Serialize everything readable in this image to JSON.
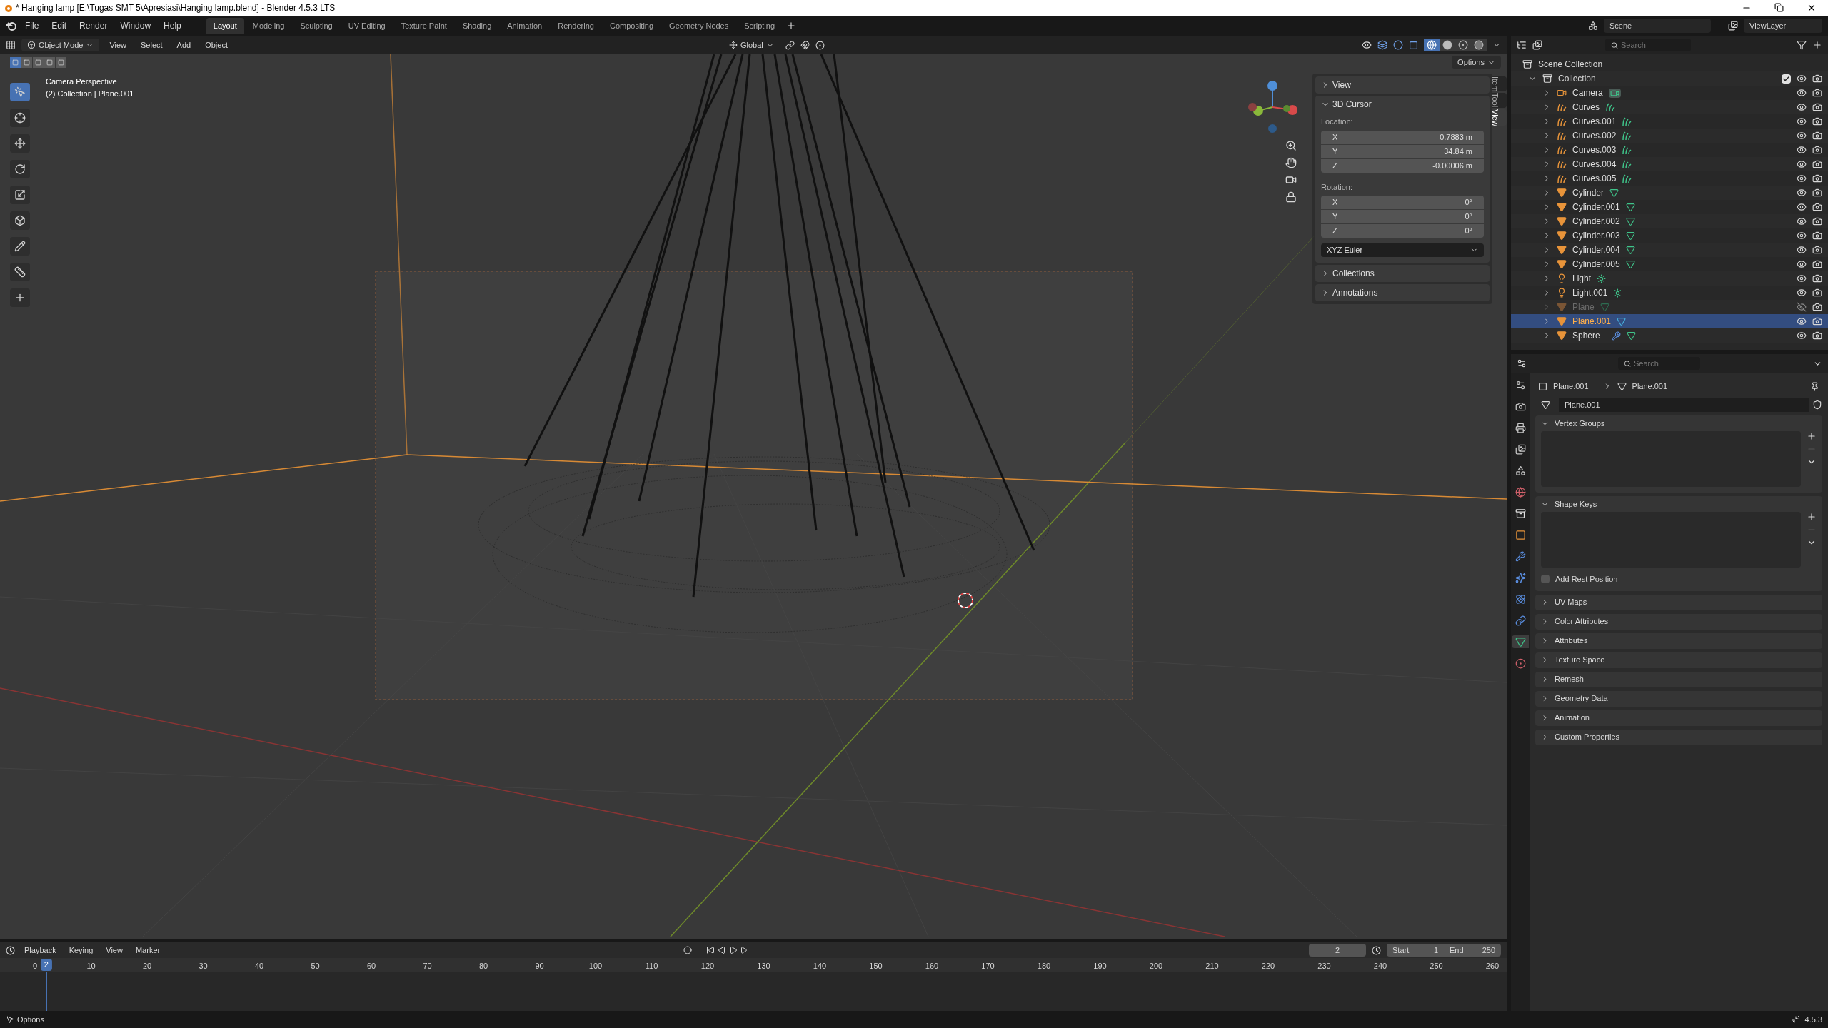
{
  "window": {
    "title": "* Hanging lamp [E:\\Tugas SMT 5\\Apresiasi\\Hanging lamp.blend] - Blender 4.5.3 LTS"
  },
  "menu": [
    "File",
    "Edit",
    "Render",
    "Window",
    "Help"
  ],
  "workspaces": [
    {
      "label": "Layout",
      "selected": true
    },
    {
      "label": "Modeling",
      "selected": false
    },
    {
      "label": "Sculpting",
      "selected": false
    },
    {
      "label": "UV Editing",
      "selected": false
    },
    {
      "label": "Texture Paint",
      "selected": false
    },
    {
      "label": "Shading",
      "selected": false
    },
    {
      "label": "Animation",
      "selected": false
    },
    {
      "label": "Rendering",
      "selected": false
    },
    {
      "label": "Compositing",
      "selected": false
    },
    {
      "label": "Geometry Nodes",
      "selected": false
    },
    {
      "label": "Scripting",
      "selected": false
    }
  ],
  "scene": "Scene",
  "view_layer": "ViewLayer",
  "viewport": {
    "mode": "Object Mode",
    "menus": [
      "View",
      "Select",
      "Add",
      "Object"
    ],
    "orientation": "Global",
    "options": "Options",
    "overlay_lines": [
      "Camera Perspective",
      "(2) Collection | Plane.001"
    ],
    "shading": [
      {
        "kind": "wireframe",
        "selected": true
      },
      {
        "kind": "solid",
        "selected": false
      },
      {
        "kind": "material",
        "selected": false
      },
      {
        "kind": "rendered",
        "selected": false
      }
    ],
    "select_modes": [
      {
        "selected": true
      },
      {
        "selected": false
      },
      {
        "selected": false
      },
      {
        "selected": false
      },
      {
        "selected": false
      }
    ],
    "tools": [
      {
        "kind": "select",
        "selected": true
      },
      {
        "kind": "cursor",
        "selected": false
      },
      {
        "kind": "move",
        "selected": false
      },
      {
        "kind": "rotate",
        "selected": false
      },
      {
        "kind": "scale",
        "selected": false
      },
      {
        "kind": "transform",
        "selected": false
      },
      {
        "kind": "annotate",
        "selected": false
      },
      {
        "kind": "measure",
        "selected": false
      },
      {
        "kind": "add",
        "selected": false
      }
    ]
  },
  "sidebar": {
    "tabs": [
      {
        "label": "Item",
        "selected": false
      },
      {
        "label": "Tool",
        "selected": false
      },
      {
        "label": "View",
        "selected": true
      }
    ],
    "panels": [
      {
        "label": "View",
        "expanded": false
      },
      {
        "label": "3D Cursor",
        "expanded": true,
        "location_label": "Location:",
        "location": [
          {
            "axis": "X",
            "value": "-0.7883 m"
          },
          {
            "axis": "Y",
            "value": "34.84 m"
          },
          {
            "axis": "Z",
            "value": "-0.00006 m"
          }
        ],
        "rotation_label": "Rotation:",
        "rotation": [
          {
            "axis": "X",
            "value": "0°"
          },
          {
            "axis": "Y",
            "value": "0°"
          },
          {
            "axis": "Z",
            "value": "0°"
          }
        ],
        "rotation_mode": "XYZ Euler"
      },
      {
        "label": "Collections",
        "expanded": false
      },
      {
        "label": "Annotations",
        "expanded": false
      }
    ]
  },
  "outliner": {
    "search": {
      "placeholder": "Search"
    },
    "root": "Scene Collection",
    "collection": {
      "name": "Collection",
      "checked": true,
      "expanded": true
    },
    "items": [
      {
        "name": "Camera",
        "kind": "camera",
        "selected": false,
        "visible": true,
        "modifier": false
      },
      {
        "name": "Curves",
        "kind": "curves",
        "selected": false,
        "visible": true,
        "modifier": false
      },
      {
        "name": "Curves.001",
        "kind": "curves",
        "selected": false,
        "visible": true,
        "modifier": false
      },
      {
        "name": "Curves.002",
        "kind": "curves",
        "selected": false,
        "visible": true,
        "modifier": false
      },
      {
        "name": "Curves.003",
        "kind": "curves",
        "selected": false,
        "visible": true,
        "modifier": false
      },
      {
        "name": "Curves.004",
        "kind": "curves",
        "selected": false,
        "visible": true,
        "modifier": false
      },
      {
        "name": "Curves.005",
        "kind": "curves",
        "selected": false,
        "visible": true,
        "modifier": false
      },
      {
        "name": "Cylinder",
        "kind": "mesh",
        "selected": false,
        "visible": true,
        "modifier": false
      },
      {
        "name": "Cylinder.001",
        "kind": "mesh",
        "selected": false,
        "visible": true,
        "modifier": false
      },
      {
        "name": "Cylinder.002",
        "kind": "mesh",
        "selected": false,
        "visible": true,
        "modifier": false
      },
      {
        "name": "Cylinder.003",
        "kind": "mesh",
        "selected": false,
        "visible": true,
        "modifier": false
      },
      {
        "name": "Cylinder.004",
        "kind": "mesh",
        "selected": false,
        "visible": true,
        "modifier": false
      },
      {
        "name": "Cylinder.005",
        "kind": "mesh",
        "selected": false,
        "visible": true,
        "modifier": false
      },
      {
        "name": "Light",
        "kind": "light",
        "selected": false,
        "visible": true,
        "modifier": false
      },
      {
        "name": "Light.001",
        "kind": "light",
        "selected": false,
        "visible": true,
        "modifier": false
      },
      {
        "name": "Plane",
        "kind": "mesh",
        "selected": false,
        "visible": false,
        "modifier": false
      },
      {
        "name": "Plane.001",
        "kind": "mesh",
        "selected": true,
        "visible": true,
        "modifier": false
      },
      {
        "name": "Sphere",
        "kind": "mesh",
        "selected": false,
        "visible": true,
        "modifier": true
      }
    ]
  },
  "properties": {
    "search": {
      "placeholder": "Search"
    },
    "tabs": [
      {
        "kind": "tool",
        "selected": false
      },
      {
        "kind": "render",
        "selected": false
      },
      {
        "kind": "output",
        "selected": false
      },
      {
        "kind": "view_layer",
        "selected": false
      },
      {
        "kind": "scene",
        "selected": false
      },
      {
        "kind": "world",
        "selected": false
      },
      {
        "kind": "collection",
        "selected": false
      },
      {
        "kind": "object",
        "selected": false
      },
      {
        "kind": "modifiers",
        "selected": false
      },
      {
        "kind": "particles",
        "selected": false
      },
      {
        "kind": "physics",
        "selected": false
      },
      {
        "kind": "constraints",
        "selected": false
      },
      {
        "kind": "data",
        "selected": true
      },
      {
        "kind": "material",
        "selected": false
      }
    ],
    "breadcrumb": [
      "Plane.001",
      "Plane.001"
    ],
    "data_name": "Plane.001",
    "panels": [
      {
        "label": "Vertex Groups",
        "expanded": true,
        "kind": "list"
      },
      {
        "label": "Shape Keys",
        "expanded": true,
        "kind": "list",
        "option": {
          "label": "Add Rest Position",
          "checked": false
        }
      },
      {
        "label": "UV Maps",
        "expanded": false
      },
      {
        "label": "Color Attributes",
        "expanded": false
      },
      {
        "label": "Attributes",
        "expanded": false
      },
      {
        "label": "Texture Space",
        "expanded": false
      },
      {
        "label": "Remesh",
        "expanded": false
      },
      {
        "label": "Geometry Data",
        "expanded": false
      },
      {
        "label": "Animation",
        "expanded": false
      },
      {
        "label": "Custom Properties",
        "expanded": false
      }
    ]
  },
  "timeline": {
    "menus": [
      "Playback",
      "Keying",
      "View",
      "Marker"
    ],
    "current_frame": "2",
    "start_label": "Start",
    "start": "1",
    "end_label": "End",
    "end": "250",
    "ticks": [
      "0",
      "10",
      "20",
      "30",
      "40",
      "50",
      "60",
      "70",
      "80",
      "90",
      "100",
      "110",
      "120",
      "130",
      "140",
      "150",
      "160",
      "170",
      "180",
      "190",
      "200",
      "210",
      "220",
      "230",
      "240",
      "250",
      "260"
    ],
    "playhead": {
      "label": "2",
      "level": 0.0077
    }
  },
  "status_bar": {
    "left": "Options",
    "version": "4.5.3"
  }
}
